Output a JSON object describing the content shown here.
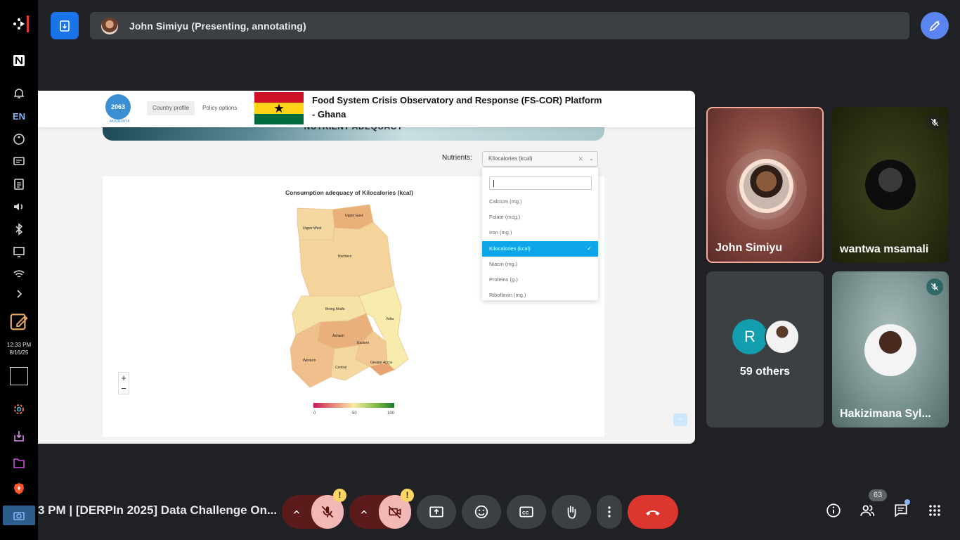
{
  "taskbar": {
    "lang": "EN",
    "time": "12:33 PM",
    "date": "8/16/25"
  },
  "presenter_bar": {
    "label": "John Simiyu (Presenting, annotating)"
  },
  "shared_screen": {
    "nav_tabs": [
      "Country profile",
      "Policy options"
    ],
    "logo_caption": "AKADEMIYA",
    "logo_text": "2063",
    "site_title": "Food System Crisis Observatory and Response (FS-COR) Platform - Ghana",
    "section_banner": "NUTRIENT ADEQUACY",
    "nutrients_label": "Nutrients:",
    "nutrients_selected": "Kilocalories (kcal)",
    "dropdown_options": [
      "Calcium (mg.)",
      "Folate (mcg.)",
      "Iron (mg.)",
      "Kilocalories (kcal)",
      "Niacin (mg.)",
      "Proteins (g.)",
      "Riboflavin (mg.)"
    ],
    "dropdown_selected_index": 3,
    "map_title": "Consumption adequacy of Kilocalories (kcal)",
    "regions": [
      "Upper West",
      "Upper East",
      "Northern",
      "Brong Ahafo",
      "Volta",
      "Ashanti",
      "Eastern",
      "Western",
      "Central",
      "Greater Accra"
    ],
    "legend_ticks": [
      "0",
      "50",
      "100"
    ],
    "zoom_in": "+",
    "zoom_out": "−"
  },
  "participants": [
    {
      "name": "John Simiyu",
      "muted": false,
      "speaking": true
    },
    {
      "name": "wantwa msamali",
      "muted": true
    },
    {
      "name": "59 others",
      "initial": "R"
    },
    {
      "name": "Hakizimana Syl...",
      "muted": true
    }
  ],
  "bottom_bar": {
    "meeting_title": "3 PM  |  [DERPIn 2025] Data Challenge On...",
    "participant_count": "63"
  },
  "colors": {
    "accent": "#1a73e8",
    "hangup": "#dc362e",
    "selected_option": "#0ea5e9"
  }
}
